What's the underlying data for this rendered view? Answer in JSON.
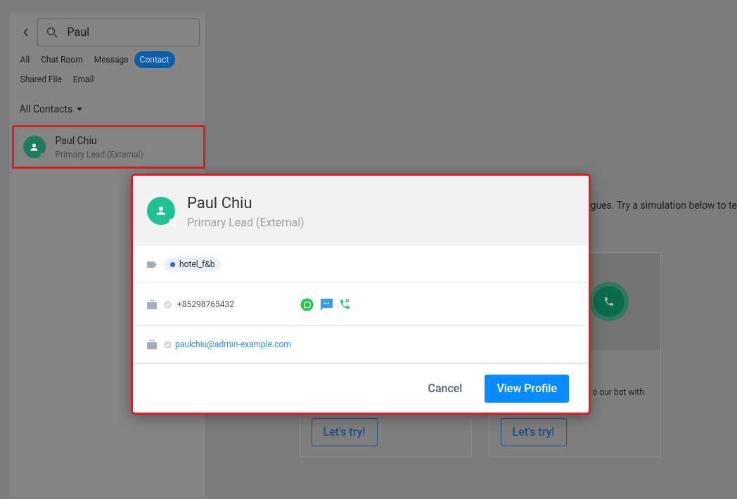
{
  "sidebar": {
    "search": {
      "value": "Paul"
    },
    "filters": [
      {
        "label": "All",
        "selected": false
      },
      {
        "label": "Chat Room",
        "selected": false
      },
      {
        "label": "Message",
        "selected": false
      },
      {
        "label": "Contact",
        "selected": true
      },
      {
        "label": "Shared File",
        "selected": false
      },
      {
        "label": "Email",
        "selected": false
      }
    ],
    "contacts_dropdown": "All Contacts",
    "contacts": [
      {
        "name": "Paul Chiu",
        "role": "Primary Lead (External)",
        "highlighted": true
      }
    ]
  },
  "workspace": {
    "intro_fragment": "gues. Try a simulation below to te",
    "cards": [
      {
        "kind": "blank",
        "button": "Let's try!"
      },
      {
        "kind": "call",
        "text_fragment": "o our bot with",
        "button": "Let's try!"
      }
    ]
  },
  "contact_modal": {
    "highlighted": true,
    "name": "Paul Chiu",
    "role": "Primary Lead (External)",
    "tags": [
      {
        "label": "hotel_f&b",
        "color": "#4a5ee8"
      }
    ],
    "phone": "+85298765432",
    "email": "paulchiu@admin-example.com",
    "cancel": "Cancel",
    "primary": "View Profile"
  }
}
